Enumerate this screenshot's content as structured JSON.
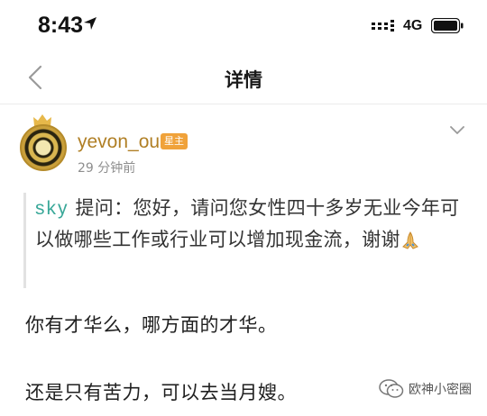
{
  "status_bar": {
    "time": "8:43",
    "network": "4G"
  },
  "nav": {
    "title": "详情",
    "back_icon": "chevron-left-icon"
  },
  "post": {
    "author": "yevon_ou",
    "author_badge": "星主",
    "time": "29 分钟前",
    "menu_icon": "chevron-down-icon",
    "question": {
      "asker": "sky",
      "prefix": " 提问：",
      "text": "您好，请问您女性四十多岁无业今年可以做哪些工作或行业可以增加现金流，谢谢"
    },
    "lines": [
      "你有才华么，哪方面的才华。",
      "还是只有苦力，可以去当月嫂。"
    ]
  },
  "watermark": {
    "text": "欧神小密圈",
    "icon": "wechat-icon"
  }
}
